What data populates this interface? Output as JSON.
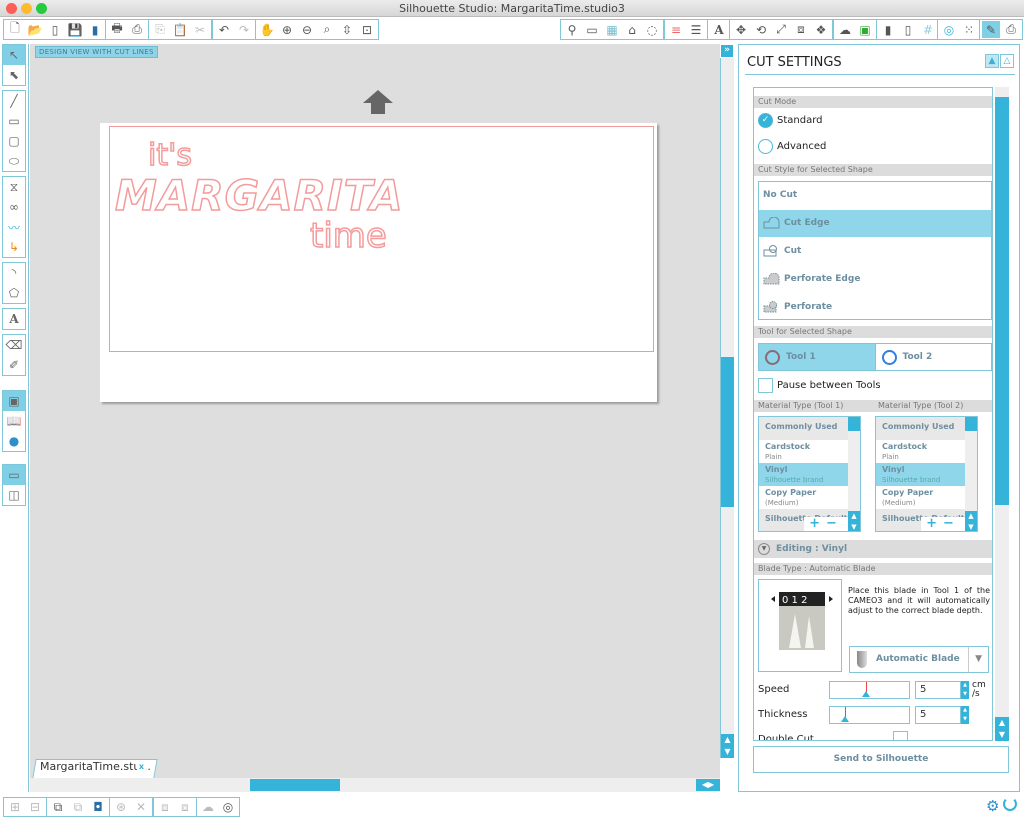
{
  "window": {
    "title": "Silhouette Studio: MargaritaTime.studio3",
    "traffic_lights": {
      "close": "#fc5f57",
      "minimize": "#fdbc2e",
      "zoom": "#28c840"
    }
  },
  "toolbar": {
    "groups": [
      [
        "new-document-icon",
        "open-folder-icon",
        "open-template-icon",
        "save-icon",
        "save-to-library-icon"
      ],
      [
        "print-icon",
        "send-to-cutter-icon"
      ],
      [
        "copy-icon",
        "paste-icon",
        "cut-icon"
      ],
      [
        "undo-icon",
        "redo-icon"
      ],
      [
        "pan-hand-icon",
        "zoom-in-icon",
        "zoom-out-icon",
        "zoom-select-icon",
        "zoom-drag-icon",
        "fit-to-page-icon"
      ],
      [
        "fill-color-icon",
        "page-settings-icon",
        "grid-icon",
        "registration-marks-icon",
        "line-color-icon"
      ],
      [
        "line-style-icon",
        "line-weight-icon"
      ],
      [
        "text-style-icon"
      ],
      [
        "transform-icon",
        "rotate-icon",
        "scale-icon",
        "align-icon",
        "replicate-icon"
      ],
      [
        "offset-icon",
        "trace-icon"
      ],
      [
        "modify-icon",
        "knife-icon",
        "grid-pattern-icon"
      ],
      [
        "trace-spiral-icon",
        "pixscan-icon"
      ],
      [
        "cut-settings-icon",
        "send-icon"
      ]
    ]
  },
  "canvas": {
    "view_badge": "DESIGN VIEW WITH CUT LINES",
    "design": {
      "line1": "it's",
      "line2": "MARGARITA",
      "line3": "time"
    },
    "cut_line_color": "#f49b9b"
  },
  "document_tab": {
    "label": "MargaritaTime.stu...",
    "close": "x"
  },
  "cut_settings": {
    "title": "CUT SETTINGS",
    "cut_mode": {
      "header": "Cut Mode",
      "options": [
        {
          "label": "Standard",
          "selected": true
        },
        {
          "label": "Advanced",
          "selected": false
        }
      ]
    },
    "cut_style": {
      "header": "Cut Style for Selected Shape",
      "options": [
        {
          "label": "No Cut",
          "selected": false
        },
        {
          "label": "Cut Edge",
          "selected": true
        },
        {
          "label": "Cut",
          "selected": false
        },
        {
          "label": "Perforate Edge",
          "selected": false
        },
        {
          "label": "Perforate",
          "selected": false
        }
      ]
    },
    "tool": {
      "header": "Tool for Selected Shape",
      "options": [
        {
          "label": "Tool 1",
          "selected": true
        },
        {
          "label": "Tool 2",
          "selected": false
        }
      ],
      "pause_label": "Pause between Tools",
      "pause_checked": false
    },
    "material": {
      "header_tool1": "Material Type (Tool 1)",
      "header_tool2": "Material Type (Tool 2)",
      "items": [
        {
          "name": "Commonly Used",
          "sub": "",
          "type": "header"
        },
        {
          "name": "Cardstock",
          "sub": "Plain",
          "type": "item"
        },
        {
          "name": "Vinyl",
          "sub": "Silhouette brand",
          "type": "selected"
        },
        {
          "name": "Copy Paper",
          "sub": "(Medium)",
          "type": "item"
        },
        {
          "name": "Silhouette Default",
          "sub": "",
          "type": "header"
        }
      ],
      "add": "+",
      "remove": "−"
    },
    "editing": {
      "label": "Editing : Vinyl",
      "blade_header": "Blade Type : Automatic Blade",
      "blade_description": "Place this blade in Tool 1 of the CAMEO3 and it will automatically adjust to the correct blade depth.",
      "blade_select": "Automatic Blade",
      "blade_dial": "0 1 2",
      "speed_label": "Speed",
      "speed_value": "5",
      "speed_unit": "cm /s",
      "speed_fraction": 0.45,
      "thickness_label": "Thickness",
      "thickness_value": "5",
      "thickness_fraction": 0.15,
      "double_cut_label": "Double Cut"
    },
    "send_button": "Send to Silhouette"
  },
  "colors": {
    "accent": "#35b3d8",
    "border": "#7fc7d9",
    "selected": "#8fd6ea"
  }
}
